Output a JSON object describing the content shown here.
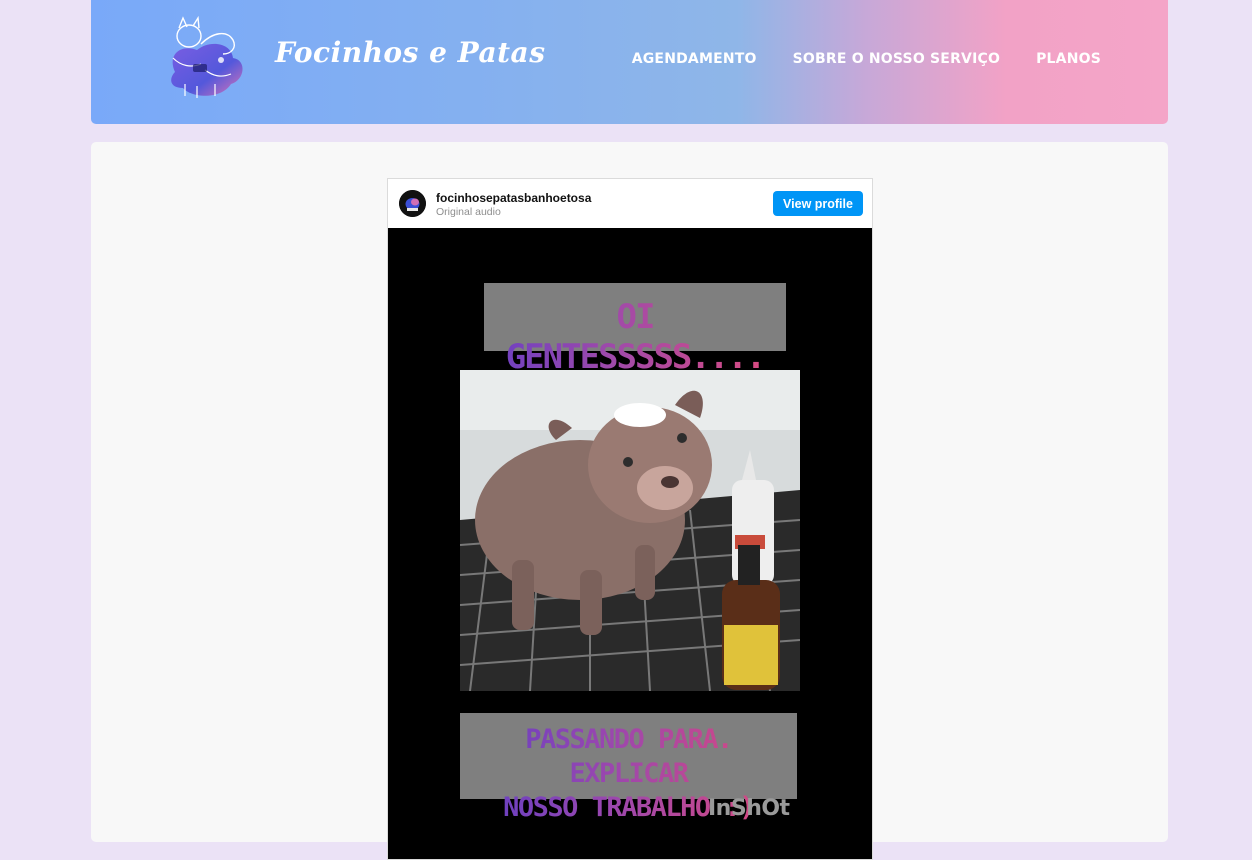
{
  "header": {
    "brand": "Focinhos e Patas",
    "logo_icon": "dog-cat-logo-icon",
    "nav": [
      {
        "label": "AGENDAMENTO"
      },
      {
        "label": "SOBRE O NOSSO SERVIÇO"
      },
      {
        "label": "PLANOS"
      }
    ]
  },
  "embed": {
    "username": "focinhosepatasbanhoetosa",
    "subtext": "Original audio",
    "button": "View profile",
    "video": {
      "banner_top": "OI GENTESSSSS....",
      "banner_bottom_line1": "PASSANDO PARA. EXPLICAR",
      "banner_bottom_line2": "NOSSO TRABALHO :)",
      "watermark": "InShOt"
    }
  },
  "colors": {
    "page_bg": "#ebe2f6",
    "header_start": "#79a9f9",
    "header_end": "#f4a5c8",
    "button_blue": "#0095f6"
  }
}
